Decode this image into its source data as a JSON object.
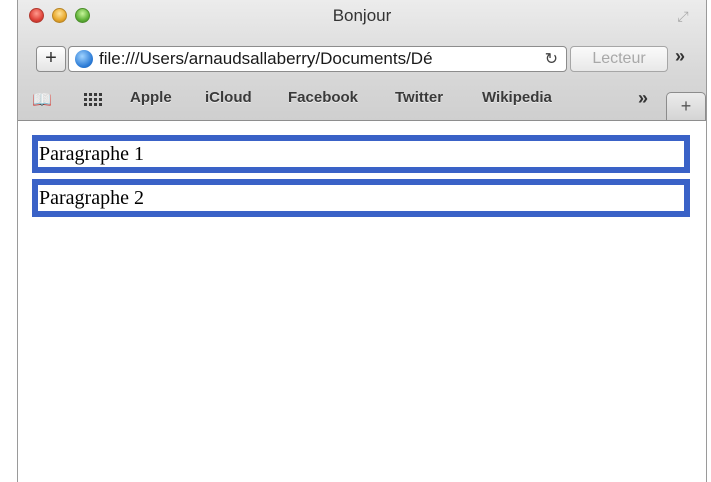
{
  "window": {
    "title": "Bonjour"
  },
  "toolbar": {
    "add_label": "+",
    "url": "file:///Users/arnaudsallaberry/Documents/Dé",
    "reload_icon": "↻",
    "reader_label": "Lecteur",
    "overflow_label": "»"
  },
  "bookmarks": {
    "items": [
      "Apple",
      "iCloud",
      "Facebook",
      "Twitter",
      "Wikipedia"
    ],
    "more_label": "»",
    "newtab_label": "+"
  },
  "content": {
    "paragraphs": [
      "Paragraphe 1",
      "Paragraphe 2"
    ]
  },
  "colors": {
    "paragraph_border": "#3a62c7"
  }
}
